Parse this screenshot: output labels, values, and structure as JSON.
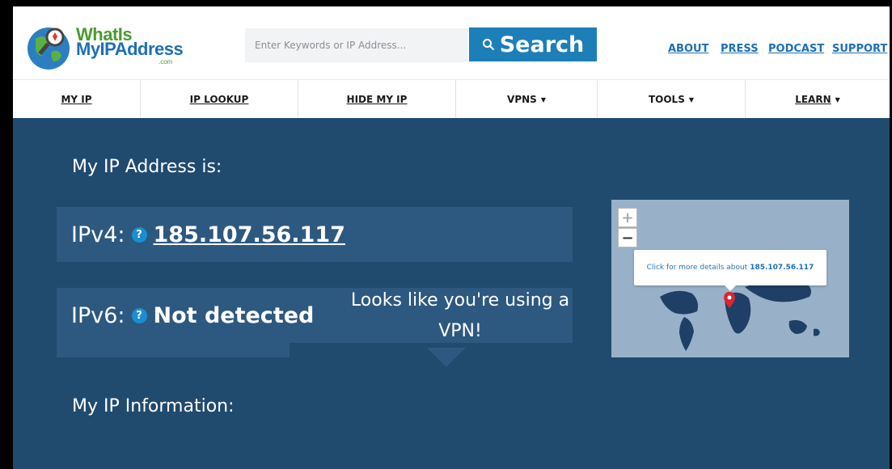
{
  "brand": {
    "line1": "WhatIs",
    "line2": "MyIPAddress",
    "suffix": ".com"
  },
  "search": {
    "placeholder": "Enter Keywords or IP Address...",
    "button_label": "Search"
  },
  "top_links": [
    "ABOUT",
    "PRESS",
    "PODCAST",
    "SUPPORT"
  ],
  "nav": [
    {
      "label": "MY IP",
      "dropdown": false
    },
    {
      "label": "IP LOOKUP",
      "dropdown": false
    },
    {
      "label": "HIDE MY IP",
      "dropdown": false
    },
    {
      "label": "VPNS",
      "dropdown": true
    },
    {
      "label": "TOOLS",
      "dropdown": true
    },
    {
      "label": "LEARN",
      "dropdown": true
    }
  ],
  "main": {
    "heading": "My IP Address is:",
    "ipv4_label": "IPv4:",
    "ipv4_value": "185.107.56.117",
    "ipv6_label": "IPv6:",
    "ipv6_value": "Not detected",
    "help_glyph": "?",
    "info_heading": "My IP Information:",
    "vpn_notice": "Looks like you're using a VPN!"
  },
  "map": {
    "zoom_in": "+",
    "zoom_out": "−",
    "tooltip_prefix": "Click for more details about",
    "tooltip_ip": "185.107.56.117"
  },
  "colors": {
    "main_bg": "#204a6e",
    "box_bg": "#2d5980",
    "accent": "#1d7fb8",
    "link": "#1d6fb8"
  }
}
